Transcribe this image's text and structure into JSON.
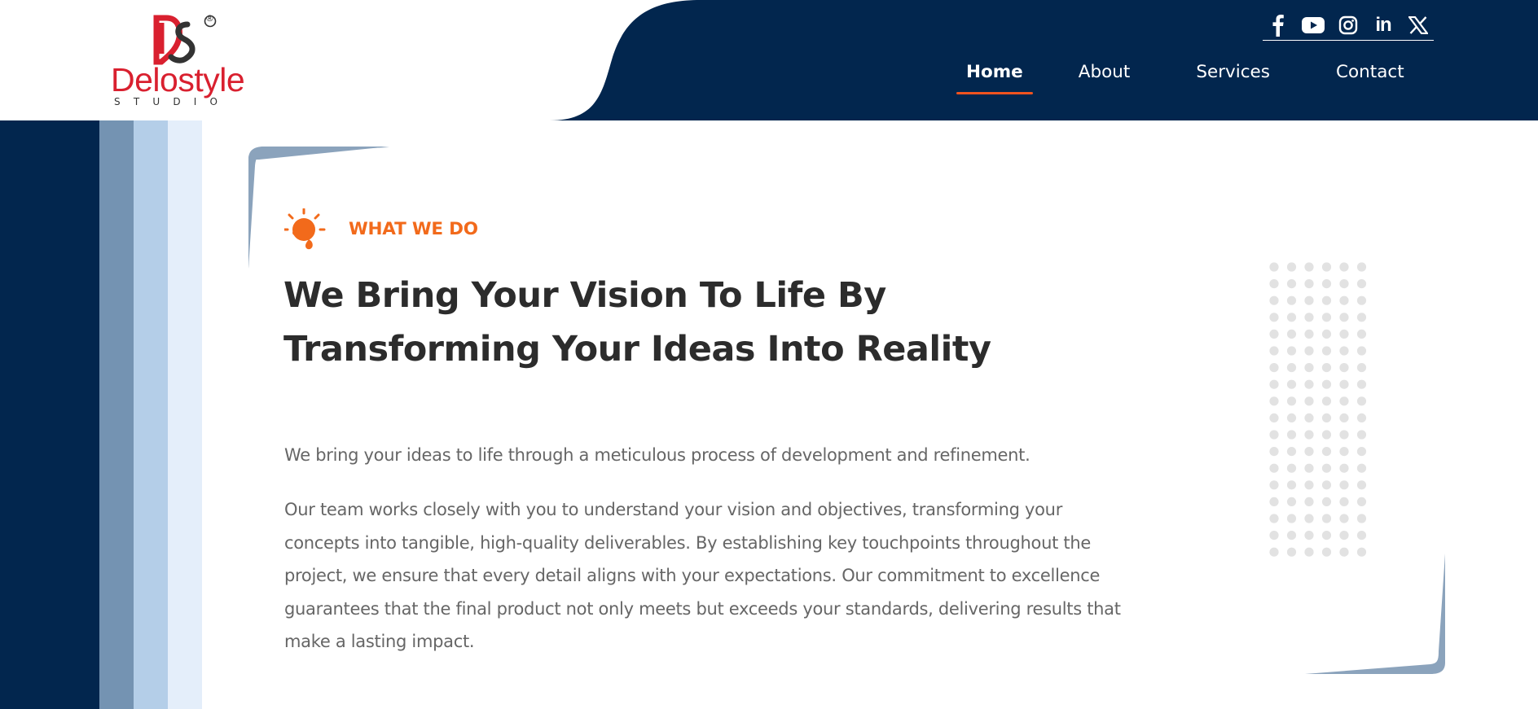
{
  "brand": {
    "name": "Delostyle",
    "sub": "STUDIO",
    "registered_mark": "®",
    "colors": {
      "red": "#d9202f",
      "navy": "#02264e",
      "orange": "#f26a1b"
    }
  },
  "header": {
    "social": [
      {
        "icon": "facebook-icon"
      },
      {
        "icon": "youtube-icon"
      },
      {
        "icon": "instagram-icon"
      },
      {
        "icon": "linkedin-icon",
        "glyph": "in"
      },
      {
        "icon": "x-twitter-icon"
      }
    ],
    "nav": [
      {
        "label": "Home",
        "active": true
      },
      {
        "label": "About",
        "active": false
      },
      {
        "label": "Services",
        "active": false
      },
      {
        "label": "Contact",
        "active": false
      }
    ]
  },
  "section": {
    "eyebrow_icon": "lightbulb-icon",
    "eyebrow": "WHAT WE DO",
    "headline_lines": [
      "We Bring Your Vision To Life By",
      "Transforming Your Ideas Into Reality"
    ],
    "intro": "We bring your ideas to life through a meticulous process of development and refinement.",
    "body_lines": [
      "Our team works closely with you to understand your vision and objectives, transforming your",
      "concepts into tangible, high-quality deliverables. By establishing key touchpoints throughout the",
      "project, we ensure that every detail aligns with your expectations. Our commitment to excellence",
      "guarantees that the final product not only meets but exceeds your standards, delivering results that",
      "make a lasting impact."
    ]
  }
}
